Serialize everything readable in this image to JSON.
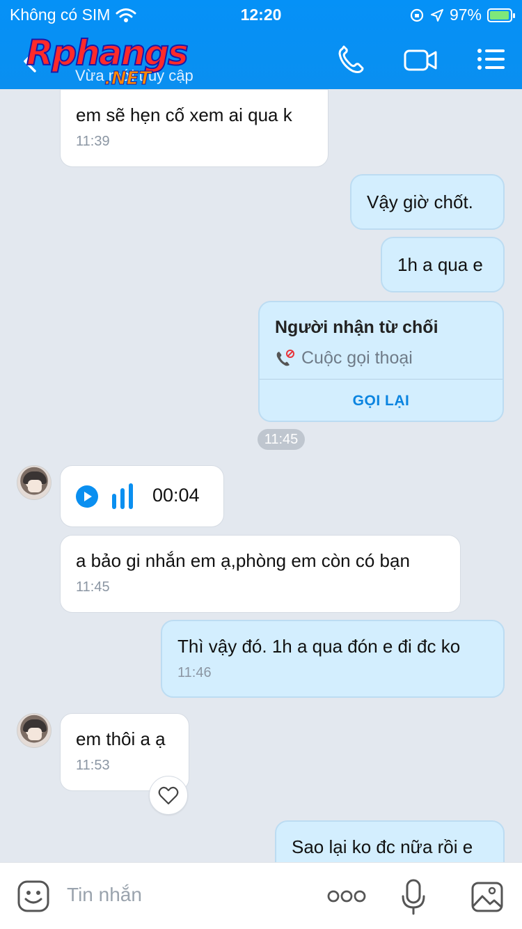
{
  "status_bar": {
    "carrier": "Không có SIM",
    "time": "12:20",
    "battery": "97%"
  },
  "header": {
    "logo_text": "Rphangs",
    "logo_suffix": ".NET",
    "subtitle": "Vừa mới truy cập",
    "icons": [
      "back-icon",
      "phone-icon",
      "video-icon",
      "menu-icon"
    ]
  },
  "messages": {
    "m1": {
      "text": "em sẽ hẹn cố xem ai qua k",
      "time": "11:39"
    },
    "m2": {
      "text": "Vậy giờ chốt."
    },
    "m3": {
      "text": "1h a qua e"
    },
    "call": {
      "title": "Người nhận từ chối",
      "subtitle": "Cuộc gọi thoại",
      "action": "GỌI LẠI",
      "time": "11:45"
    },
    "voice": {
      "duration": "00:04"
    },
    "m4": {
      "text": "a bảo gi nhắn em ạ,phòng em còn có bạn",
      "time": "11:45"
    },
    "m5": {
      "text": "Thì vậy đó. 1h a qua đón e đi đc ko",
      "time": "11:46"
    },
    "m6": {
      "text": "em thôi a ạ",
      "time": "11:53"
    },
    "m7": {
      "text": "Sao lại ko đc nữa rồi e"
    }
  },
  "input": {
    "placeholder": "Tin nhắn"
  },
  "colors": {
    "header_blue": "#0591f7",
    "outgoing_bubble": "#d3eefe",
    "incoming_bubble": "#ffffff",
    "accent": "#0a84e0",
    "background": "#e3e8ef"
  }
}
